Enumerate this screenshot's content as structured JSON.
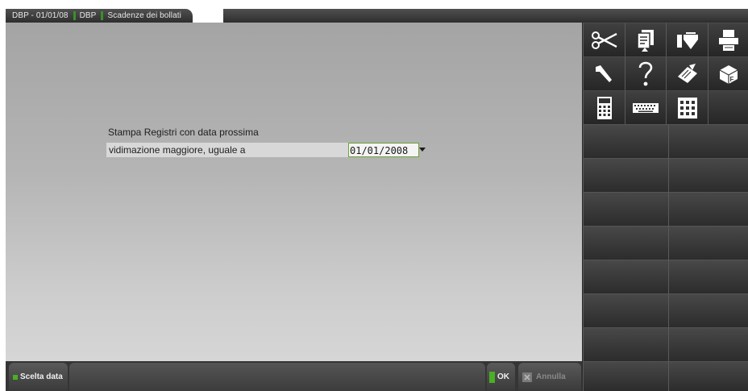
{
  "breadcrumb": {
    "items": [
      "DBP - 01/01/08",
      "DBP",
      "Scadenze dei bollati"
    ]
  },
  "form": {
    "title": "Stampa Registri con data prossima",
    "label": "vidimazione maggiore, uguale a",
    "date_value": "01/01/2008"
  },
  "bottom_bar": {
    "scelta_data": "Scelta data",
    "ok": "OK",
    "annulla": "Annulla"
  },
  "toolbar": {
    "icons": [
      "scissors-icon",
      "copy-documents-icon",
      "hand-tray-icon",
      "printer-icon",
      "wrench-icon",
      "help-question-icon",
      "notepad-edit-icon",
      "function-box-icon",
      "calculator-icon",
      "keyboard-icon",
      "grid-keypad-icon"
    ]
  },
  "colors": {
    "accent_green": "#49b023",
    "input_border": "#6aa436",
    "panel_gray": "#b5b5b5",
    "dark_bar": "#353535"
  }
}
